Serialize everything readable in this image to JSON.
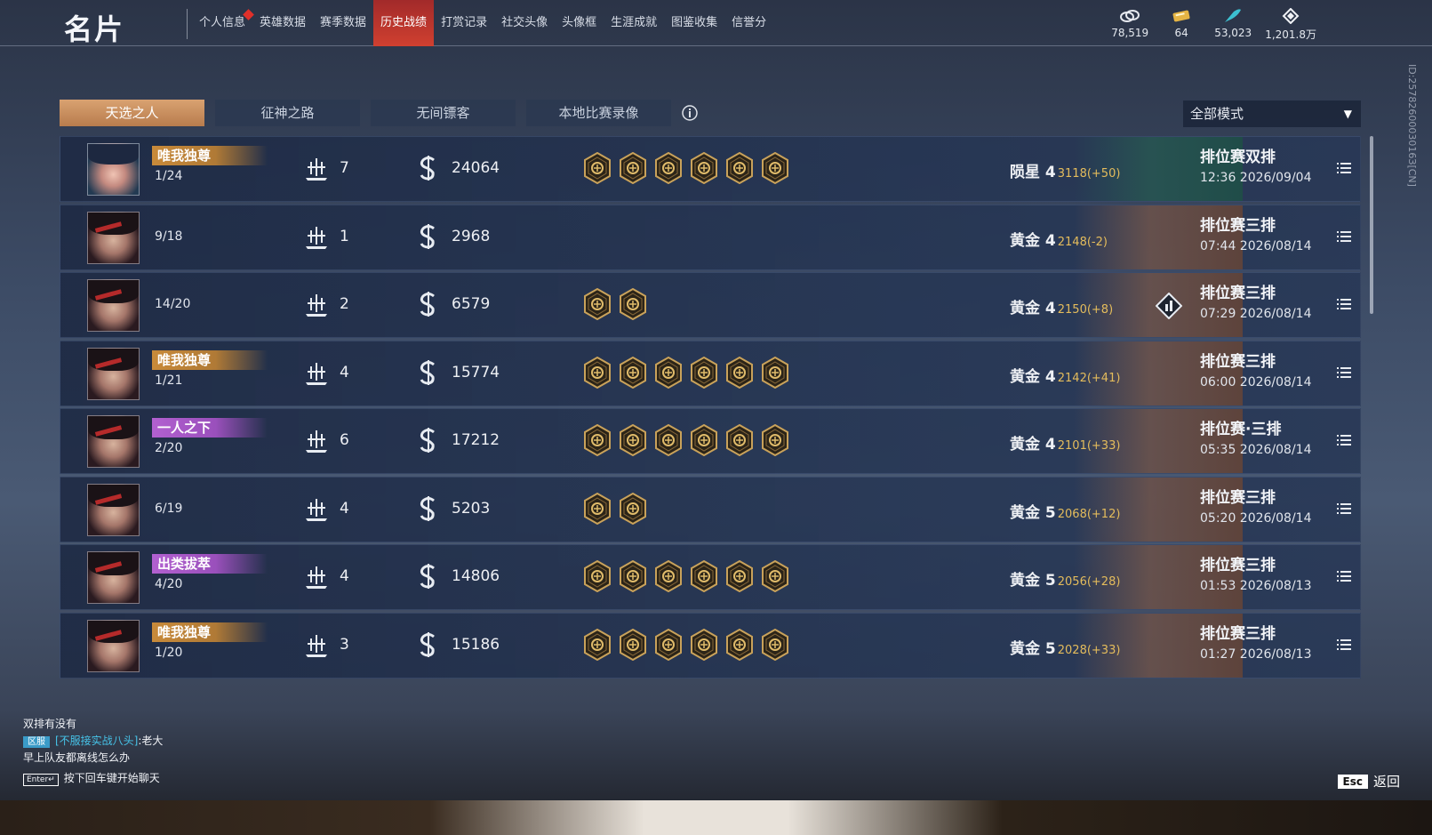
{
  "header": {
    "title": "名片",
    "nav": [
      {
        "label": "个人信息",
        "active": false,
        "dot": true
      },
      {
        "label": "英雄数据",
        "active": false
      },
      {
        "label": "赛季数据",
        "active": false
      },
      {
        "label": "历史战绩",
        "active": true
      },
      {
        "label": "打赏记录",
        "active": false
      },
      {
        "label": "社交头像",
        "active": false
      },
      {
        "label": "头像框",
        "active": false
      },
      {
        "label": "生涯成就",
        "active": false
      },
      {
        "label": "图鉴收集",
        "active": false
      },
      {
        "label": "信誉分",
        "active": false
      }
    ],
    "currencies": [
      {
        "icon": "gold-taels-icon",
        "value": "78,519"
      },
      {
        "icon": "ticket-icon",
        "value": "64"
      },
      {
        "icon": "feather-icon",
        "value": "53,023"
      },
      {
        "icon": "diamond-icon",
        "value": "1,201.8万"
      }
    ],
    "player_id": "ID:2578260003016З[CN]"
  },
  "tabs": [
    "天选之人",
    "征神之路",
    "无间镖客",
    "本地比赛录像"
  ],
  "active_tab": 0,
  "mode_select": {
    "value": "全部模式"
  },
  "matches": [
    {
      "avatar": "special",
      "title": "唯我独尊",
      "title_color": "gold",
      "rank": "1/24",
      "kills": "7",
      "score": "24064",
      "medals": 6,
      "tier": "陨星 4",
      "points": "3118(+50)",
      "banner": "green",
      "mvp": false,
      "type": "排位赛双排",
      "time": "12:36  2026/09/04"
    },
    {
      "avatar": "normal",
      "title": "",
      "title_color": "",
      "rank": "9/18",
      "kills": "1",
      "score": "2968",
      "medals": 0,
      "tier": "黄金 4",
      "points": "2148(-2)",
      "banner": "brown",
      "mvp": false,
      "type": "排位赛三排",
      "time": "07:44  2026/08/14"
    },
    {
      "avatar": "normal",
      "title": "",
      "title_color": "",
      "rank": "14/20",
      "kills": "2",
      "score": "6579",
      "medals": 2,
      "tier": "黄金 4",
      "points": "2150(+8)",
      "banner": "brown",
      "mvp": true,
      "type": "排位赛三排",
      "time": "07:29  2026/08/14"
    },
    {
      "avatar": "normal",
      "title": "唯我独尊",
      "title_color": "gold",
      "rank": "1/21",
      "kills": "4",
      "score": "15774",
      "medals": 6,
      "tier": "黄金 4",
      "points": "2142(+41)",
      "banner": "brown",
      "mvp": false,
      "type": "排位赛三排",
      "time": "06:00  2026/08/14"
    },
    {
      "avatar": "normal",
      "title": "一人之下",
      "title_color": "purple",
      "rank": "2/20",
      "kills": "6",
      "score": "17212",
      "medals": 6,
      "tier": "黄金 4",
      "points": "2101(+33)",
      "banner": "brown",
      "mvp": false,
      "type": "排位赛·三排",
      "time": "05:35  2026/08/14"
    },
    {
      "avatar": "normal",
      "title": "",
      "title_color": "",
      "rank": "6/19",
      "kills": "4",
      "score": "5203",
      "medals": 2,
      "tier": "黄金 5",
      "points": "2068(+12)",
      "banner": "brown",
      "mvp": false,
      "type": "排位赛三排",
      "time": "05:20  2026/08/14"
    },
    {
      "avatar": "normal",
      "title": "出类拔萃",
      "title_color": "purple",
      "rank": "4/20",
      "kills": "4",
      "score": "14806",
      "medals": 6,
      "tier": "黄金 5",
      "points": "2056(+28)",
      "banner": "brown",
      "mvp": false,
      "type": "排位赛三排",
      "time": "01:53  2026/08/13"
    },
    {
      "avatar": "normal",
      "title": "唯我独尊",
      "title_color": "gold",
      "rank": "1/20",
      "kills": "3",
      "score": "15186",
      "medals": 6,
      "tier": "黄金 5",
      "points": "2028(+33)",
      "banner": "brown",
      "mvp": false,
      "type": "排位赛三排",
      "time": "01:27  2026/08/13"
    }
  ],
  "chat": {
    "line1": "双排有没有",
    "tag": "区服",
    "name": "[不服接实战八头]",
    "msg": ":老大",
    "line3": "早上队友都离线怎么办",
    "enter_key": "Enter↵",
    "hint": "按下回车键开始聊天"
  },
  "footer": {
    "esc_key": "Esc",
    "back_label": "返回"
  }
}
